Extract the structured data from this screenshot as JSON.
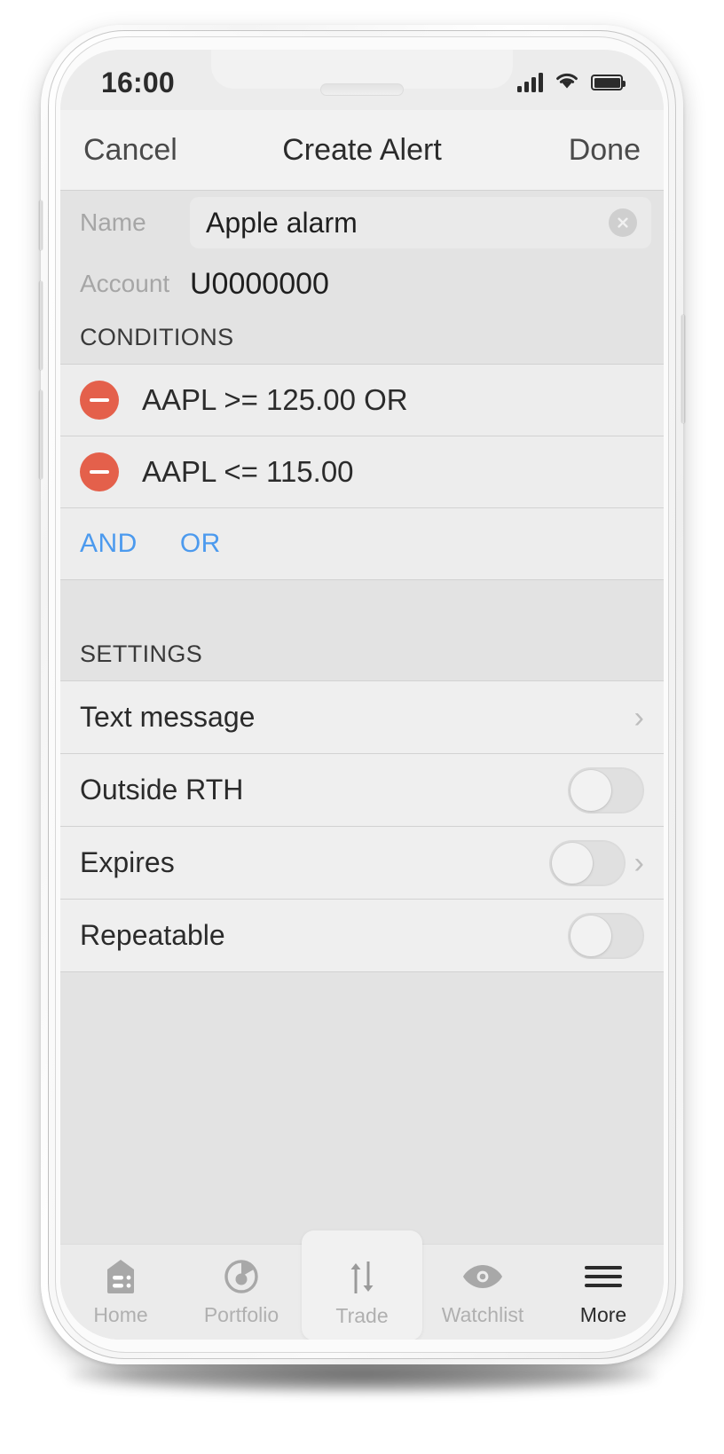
{
  "status_bar": {
    "time": "16:00",
    "signal_icon": "cellular-signal-icon",
    "wifi_icon": "wifi-icon",
    "battery_icon": "battery-full-icon"
  },
  "nav_bar": {
    "cancel_label": "Cancel",
    "title": "Create Alert",
    "done_label": "Done"
  },
  "form": {
    "name_label": "Name",
    "name_value": "Apple alarm",
    "name_placeholder": "Name",
    "clear_icon": "clear-circle-icon",
    "account_label": "Account",
    "account_value": "U0000000"
  },
  "conditions": {
    "header": "CONDITIONS",
    "items": [
      {
        "text": "AAPL >= 125.00 OR",
        "remove_icon": "minus-circle-icon"
      },
      {
        "text": "AAPL <= 115.00",
        "remove_icon": "minus-circle-icon"
      }
    ],
    "logic_buttons": [
      {
        "label": "AND"
      },
      {
        "label": "OR"
      }
    ]
  },
  "settings": {
    "header": "SETTINGS",
    "rows": [
      {
        "label": "Text message",
        "type": "disclosure",
        "chevron_icon": "chevron-right-icon"
      },
      {
        "label": "Outside RTH",
        "type": "toggle",
        "toggle_on": false
      },
      {
        "label": "Expires",
        "type": "toggle-disclosure",
        "toggle_on": false,
        "chevron_icon": "chevron-right-icon"
      },
      {
        "label": "Repeatable",
        "type": "toggle",
        "toggle_on": false
      }
    ]
  },
  "tab_bar": {
    "tabs": [
      {
        "label": "Home",
        "icon": "home-icon",
        "active": false,
        "raised": false
      },
      {
        "label": "Portfolio",
        "icon": "portfolio-icon",
        "active": false,
        "raised": false
      },
      {
        "label": "Trade",
        "icon": "trade-arrows-icon",
        "active": false,
        "raised": true
      },
      {
        "label": "Watchlist",
        "icon": "eye-icon",
        "active": false,
        "raised": false
      },
      {
        "label": "More",
        "icon": "hamburger-menu-icon",
        "active": true,
        "raised": false
      }
    ]
  },
  "colors": {
    "accent_blue": "#4c9aee",
    "destructive_red": "#e4604b",
    "screen_bg": "#e3e3e3",
    "row_bg": "#efefef",
    "text_primary": "#2b2b2b",
    "text_muted": "#a6a6a6"
  }
}
